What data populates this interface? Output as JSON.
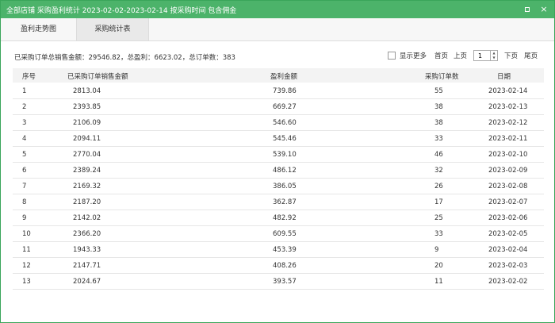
{
  "window": {
    "title": "全部店铺 采购盈利统计 2023-02-02-2023-02-14 按采购时间 包含佣金",
    "restore_label": "",
    "close_label": "×"
  },
  "tabs": [
    {
      "label": "盈利走势图"
    },
    {
      "label": "采购统计表"
    }
  ],
  "summary": "已采购订单总销售金额：29546.82，总盈利：6623.02，总订单数：383",
  "pager": {
    "show_more": "显示更多",
    "first": "首页",
    "prev": "上页",
    "page": "1",
    "next": "下页",
    "last": "尾页"
  },
  "table": {
    "headers": [
      "序号",
      "已采购订单销售金额",
      "盈利金额",
      "采购订单数",
      "日期"
    ],
    "rows": [
      [
        "1",
        "2813.04",
        "739.86",
        "55",
        "2023-02-14"
      ],
      [
        "2",
        "2393.85",
        "669.27",
        "38",
        "2023-02-13"
      ],
      [
        "3",
        "2106.09",
        "546.60",
        "38",
        "2023-02-12"
      ],
      [
        "4",
        "2094.11",
        "545.46",
        "33",
        "2023-02-11"
      ],
      [
        "5",
        "2770.04",
        "539.10",
        "46",
        "2023-02-10"
      ],
      [
        "6",
        "2389.24",
        "486.12",
        "32",
        "2023-02-09"
      ],
      [
        "7",
        "2169.32",
        "386.05",
        "26",
        "2023-02-08"
      ],
      [
        "8",
        "2187.20",
        "362.87",
        "17",
        "2023-02-07"
      ],
      [
        "9",
        "2142.02",
        "482.92",
        "25",
        "2023-02-06"
      ],
      [
        "10",
        "2366.20",
        "609.55",
        "33",
        "2023-02-05"
      ],
      [
        "11",
        "1943.33",
        "453.39",
        "9",
        "2023-02-04"
      ],
      [
        "12",
        "2147.71",
        "408.26",
        "20",
        "2023-02-03"
      ],
      [
        "13",
        "2024.67",
        "393.57",
        "11",
        "2023-02-02"
      ]
    ]
  },
  "colors": {
    "titlebar": "#4cb36a",
    "border": "#3aa55a"
  }
}
